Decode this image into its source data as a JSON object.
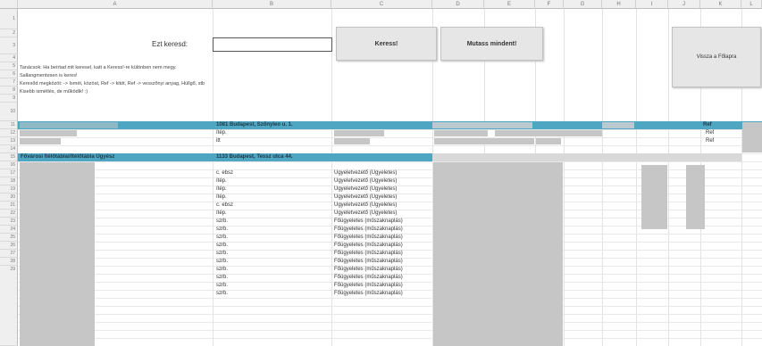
{
  "columns": [
    "A",
    "B",
    "C",
    "D",
    "E",
    "F",
    "G",
    "H",
    "I",
    "J",
    "K",
    "L"
  ],
  "rows": [
    "1",
    "2",
    "3",
    "4",
    "5",
    "6",
    "7",
    "8",
    "9",
    "10",
    "11",
    "12",
    "13",
    "14",
    "15",
    "16",
    "17",
    "18",
    "19",
    "20",
    "21",
    "22",
    "23",
    "24",
    "25",
    "26",
    "27",
    "28",
    "29"
  ],
  "search": {
    "label": "Ezt keresd:",
    "value": ""
  },
  "buttons": {
    "search": "Keress!",
    "show_all": "Mutass mindent!",
    "home": "Vissza a Főlapra"
  },
  "notes": [
    "Tanácsok: Ha beírtad mit keresel, katt a Keress!-re különben nem megy.",
    "Sallangmentesen is keres!",
    "Keresőd megközöt: -> Ismét, közöst, Ref -> kitöt, Ref -> vesszőnyi anyag, Hüllgő, stb",
    "Kisebb ismétlés, de működik! :)"
  ],
  "colors": {
    "teal": "#4ea6c3",
    "grey": "#c6c6c6"
  },
  "row10": {
    "address": "1081 Budapest, Szőnyleo u. 1.",
    "k": "Ref"
  },
  "row11": {
    "b": "ítép.",
    "k": "Ref"
  },
  "row12": {
    "b": "itt",
    "k": "Ref"
  },
  "row13": {
    "a": "Fővárosi Ítélőtáblai/Ítélőtábla Ügyész",
    "b": "1133 Budapest, Tessz utca 44."
  },
  "list_rows": [
    {
      "b": "c. ebsz",
      "c": "Ügyeletvezető (Ügyeletes)"
    },
    {
      "b": "ítép.",
      "c": "Ügyeletvezető (Ügyeletes)"
    },
    {
      "b": "ítép.",
      "c": "Ügyeletvezető (Ügyeletes)"
    },
    {
      "b": "ítép.",
      "c": "Ügyeletvezető (Ügyeletes)"
    },
    {
      "b": "c. ebsz",
      "c": "Ügyeletvezető (Ügyeletes)"
    },
    {
      "b": "ítép.",
      "c": "Ügyeletvezető (Ügyeletes)"
    },
    {
      "b": "szrb.",
      "c": "Főügyeletes (műszaknaplás)"
    },
    {
      "b": "szrb.",
      "c": "Főügyeletes (műszaknaplás)"
    },
    {
      "b": "szrb.",
      "c": "Főügyeletes (műszaknaplás)"
    },
    {
      "b": "szrb.",
      "c": "Főügyeletes (műszaknaplás)"
    },
    {
      "b": "szrb.",
      "c": "Főügyeletes (műszaknaplás)"
    },
    {
      "b": "szrb.",
      "c": "Főügyeletes (műszaknaplás)"
    },
    {
      "b": "szrb.",
      "c": "Főügyeletes (műszaknaplás)"
    },
    {
      "b": "szrb.",
      "c": "Főügyeletes (műszaknaplás)"
    },
    {
      "b": "szrb.",
      "c": "Főügyeletes (műszaknaplás)"
    },
    {
      "b": "szrb.",
      "c": "Főügyeletes (műszaknaplás)"
    }
  ]
}
